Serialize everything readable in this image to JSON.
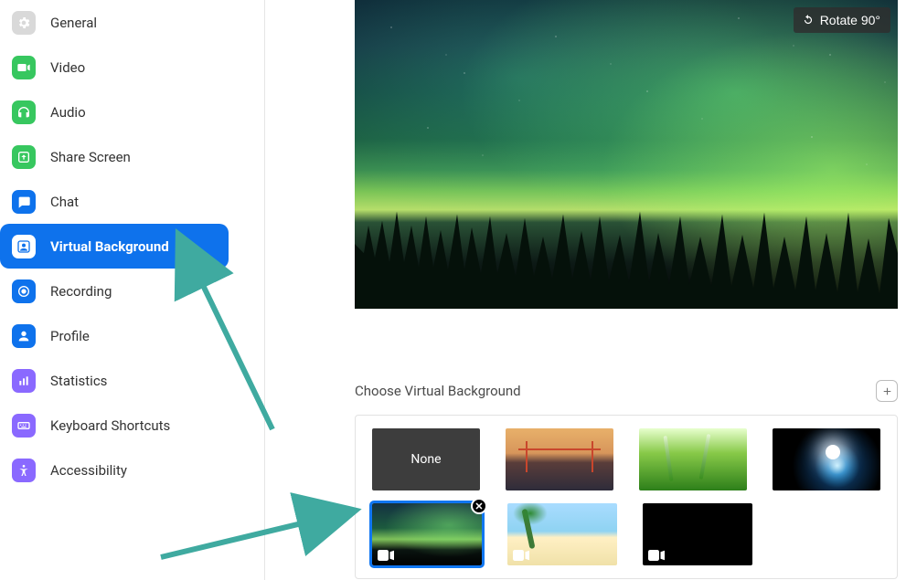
{
  "sidebar": {
    "items": [
      {
        "label": "General",
        "icon": "gear"
      },
      {
        "label": "Video",
        "icon": "video"
      },
      {
        "label": "Audio",
        "icon": "headphones"
      },
      {
        "label": "Share Screen",
        "icon": "share"
      },
      {
        "label": "Chat",
        "icon": "chat"
      },
      {
        "label": "Virtual Background",
        "icon": "person-box",
        "active": true
      },
      {
        "label": "Recording",
        "icon": "record"
      },
      {
        "label": "Profile",
        "icon": "person"
      },
      {
        "label": "Statistics",
        "icon": "stats"
      },
      {
        "label": "Keyboard Shortcuts",
        "icon": "keyboard"
      },
      {
        "label": "Accessibility",
        "icon": "accessibility"
      }
    ]
  },
  "preview": {
    "rotate_label": "Rotate 90°"
  },
  "backgrounds": {
    "header": "Choose Virtual Background",
    "none_label": "None",
    "options": [
      {
        "id": "none",
        "is_none": true
      },
      {
        "id": "bridge",
        "is_video": false
      },
      {
        "id": "grass",
        "is_video": false
      },
      {
        "id": "earth",
        "is_video": false
      },
      {
        "id": "aurora",
        "is_video": true,
        "selected": true,
        "removable": true
      },
      {
        "id": "beach",
        "is_video": true
      },
      {
        "id": "black",
        "is_video": true
      }
    ]
  }
}
